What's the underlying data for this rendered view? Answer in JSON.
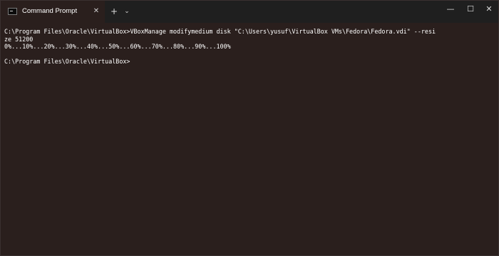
{
  "window": {
    "tab_title": "Command Prompt",
    "tab_icon": "terminal-icon",
    "close_tab": "✕",
    "new_tab": "+",
    "dropdown": "⌄",
    "minimize": "—",
    "maximize": "☐",
    "close": "✕"
  },
  "console": {
    "command_line_1": "C:\\Program Files\\Oracle\\VirtualBox>VBoxManage modifymedium disk \"C:\\Users\\yusuf\\VirtualBox VMs\\Fedora\\Fedora.vdi\" --resi",
    "command_line_2": "ze 51200",
    "progress": "0%...10%...20%...30%...40%...50%...60%...70%...80%...90%...100%",
    "prompt": "C:\\Program Files\\Oracle\\VirtualBox>"
  },
  "colors": {
    "console_bg": "#2a1f1d",
    "titlebar_bg": "#1f1f1f",
    "text": "#ffffff"
  }
}
